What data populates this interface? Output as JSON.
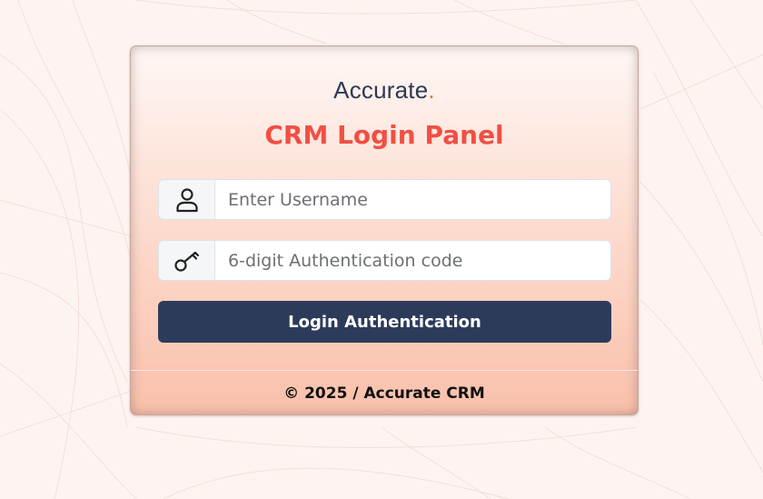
{
  "brand": {
    "logo_text": "Accurate",
    "logo_dot": ".",
    "accent_color": "#f06a3a",
    "primary_color": "#2d3b5b"
  },
  "panel": {
    "title": "CRM Login Panel",
    "title_color": "#f24f43"
  },
  "form": {
    "username": {
      "icon": "user-icon",
      "value": "",
      "placeholder": "Enter Username"
    },
    "auth_code": {
      "icon": "key-icon",
      "value": "",
      "placeholder": "6-digit Authentication code"
    },
    "submit_label": "Login Authentication"
  },
  "footer": {
    "text": "© 2025 / Accurate CRM"
  }
}
